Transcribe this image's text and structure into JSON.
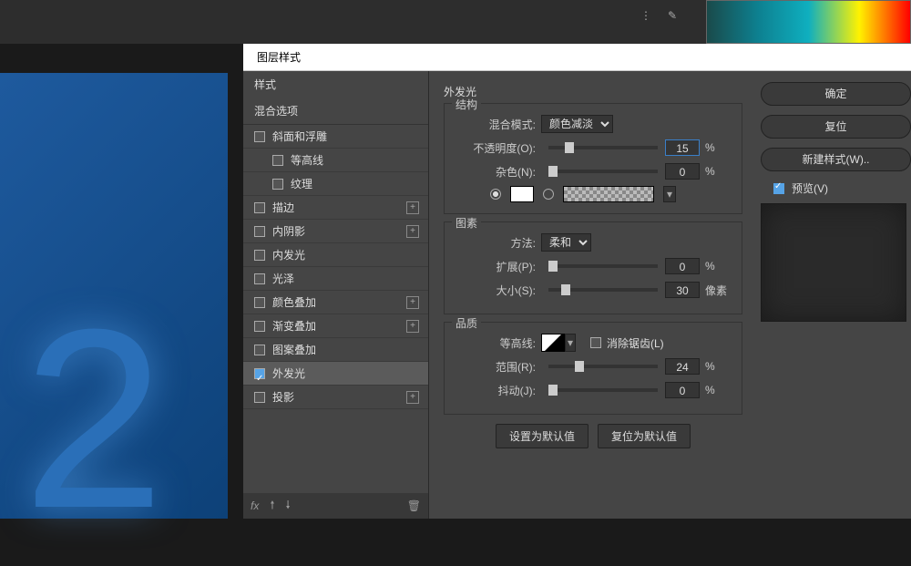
{
  "dialog_title": "图层样式",
  "styles_header": "样式",
  "blend_options": "混合选项",
  "style_list": [
    {
      "label": "斜面和浮雕",
      "indent": false,
      "plus": false
    },
    {
      "label": "等高线",
      "indent": true,
      "plus": false
    },
    {
      "label": "纹理",
      "indent": true,
      "plus": false
    },
    {
      "label": "描边",
      "indent": false,
      "plus": true
    },
    {
      "label": "内阴影",
      "indent": false,
      "plus": true
    },
    {
      "label": "内发光",
      "indent": false,
      "plus": false
    },
    {
      "label": "光泽",
      "indent": false,
      "plus": false
    },
    {
      "label": "颜色叠加",
      "indent": false,
      "plus": true
    },
    {
      "label": "渐变叠加",
      "indent": false,
      "plus": true
    },
    {
      "label": "图案叠加",
      "indent": false,
      "plus": false
    },
    {
      "label": "外发光",
      "indent": false,
      "plus": false,
      "checked": true,
      "active": true
    },
    {
      "label": "投影",
      "indent": false,
      "plus": true
    }
  ],
  "footer_fx": "fx",
  "section_title": "外发光",
  "fs_structure": "结构",
  "fs_elements": "图素",
  "fs_quality": "品质",
  "labels": {
    "blend_mode": "混合模式:",
    "opacity": "不透明度(O):",
    "noise": "杂色(N):",
    "technique": "方法:",
    "spread": "扩展(P):",
    "size": "大小(S):",
    "contour": "等高线:",
    "antialias": "消除锯齿(L)",
    "range": "范围(R):",
    "jitter": "抖动(J):"
  },
  "values": {
    "blend_mode": "颜色减淡",
    "opacity": "15",
    "noise": "0",
    "technique": "柔和",
    "spread": "0",
    "size": "30",
    "range": "24",
    "jitter": "0"
  },
  "units": {
    "pct": "%",
    "px": "像素"
  },
  "buttons": {
    "default": "设置为默认值",
    "reset": "复位为默认值",
    "ok": "确定",
    "cancel": "复位",
    "new_style": "新建样式(W)..",
    "preview": "预览(V)"
  }
}
